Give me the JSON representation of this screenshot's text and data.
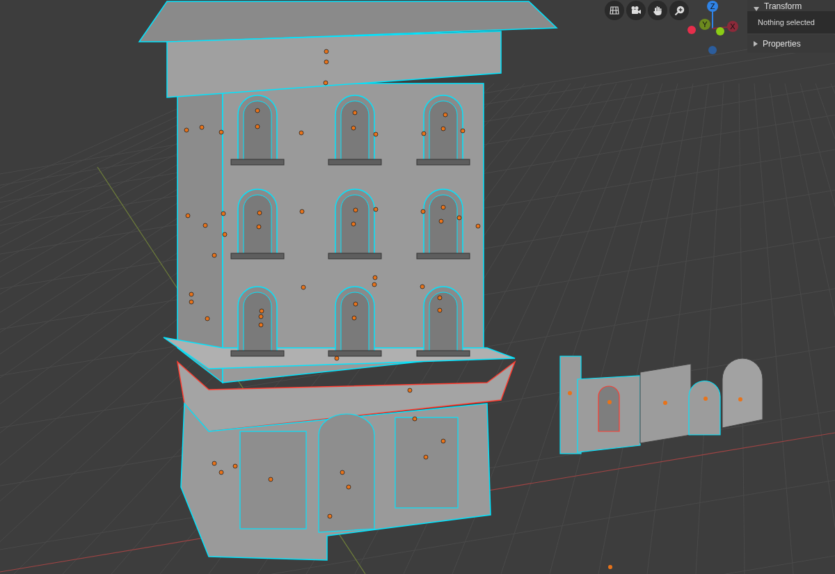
{
  "navigation_tools": [
    {
      "kind": "grid"
    },
    {
      "kind": "camera"
    },
    {
      "kind": "hand"
    },
    {
      "kind": "zoom"
    }
  ],
  "axis_gizmo": {
    "labels": [
      "Z",
      "Y",
      "X"
    ]
  },
  "sidebar": {
    "panels": [
      {
        "title": "Transform",
        "expanded": true,
        "content": "Nothing selected"
      },
      {
        "title": "Properties",
        "expanded": false
      }
    ]
  }
}
